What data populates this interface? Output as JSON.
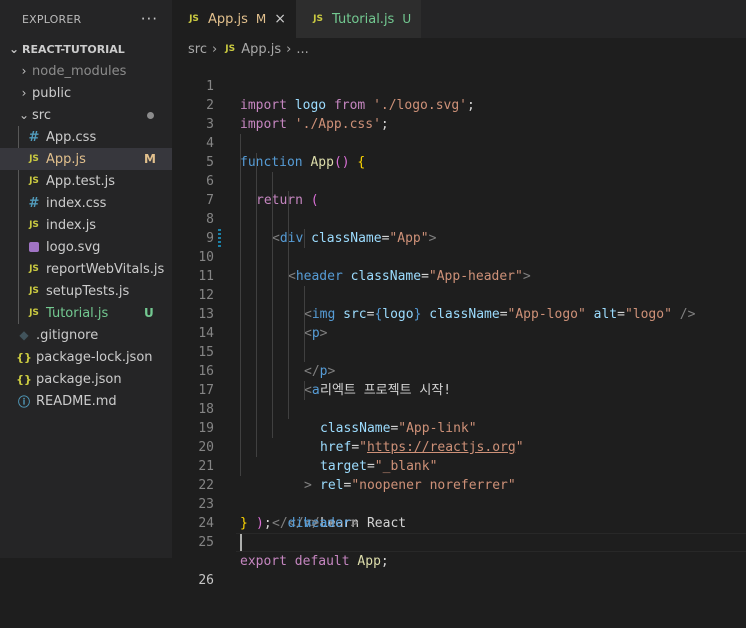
{
  "sidebar": {
    "title": "EXPLORER",
    "more_icon": "ellipsis-icon",
    "project": "REACT-TUTORIAL",
    "items": [
      {
        "label": "node_modules",
        "kind": "folder",
        "expanded": false,
        "muted": true
      },
      {
        "label": "public",
        "kind": "folder",
        "expanded": false
      },
      {
        "label": "src",
        "kind": "folder",
        "expanded": true,
        "status": "modified-dot"
      },
      {
        "label": "App.css",
        "kind": "css",
        "indent": 1
      },
      {
        "label": "App.js",
        "kind": "js",
        "indent": 1,
        "selected": true,
        "badge": "M"
      },
      {
        "label": "App.test.js",
        "kind": "js",
        "indent": 1
      },
      {
        "label": "index.css",
        "kind": "css",
        "indent": 1
      },
      {
        "label": "index.js",
        "kind": "js",
        "indent": 1
      },
      {
        "label": "logo.svg",
        "kind": "svg",
        "indent": 1
      },
      {
        "label": "reportWebVitals.js",
        "kind": "js",
        "indent": 1
      },
      {
        "label": "setupTests.js",
        "kind": "js",
        "indent": 1
      },
      {
        "label": "Tutorial.js",
        "kind": "js",
        "indent": 1,
        "badge": "U"
      },
      {
        "label": ".gitignore",
        "kind": "git"
      },
      {
        "label": "package-lock.json",
        "kind": "json"
      },
      {
        "label": "package.json",
        "kind": "json"
      },
      {
        "label": "README.md",
        "kind": "info"
      }
    ]
  },
  "tabs": [
    {
      "label": "App.js",
      "mark": "M",
      "active": true,
      "close": "×"
    },
    {
      "label": "Tutorial.js",
      "mark": "U",
      "active": false
    }
  ],
  "breadcrumb": {
    "folder": "src",
    "file": "App.js",
    "tail": "..."
  },
  "icons": {
    "js": "JS",
    "css": "#",
    "json": "{}",
    "info": "ⓘ",
    "git": "◆"
  },
  "colors": {
    "modified": "#e2c08d",
    "untracked": "#73c991",
    "background": "#1e1e1e"
  },
  "code": {
    "line_numbers": [
      "1",
      "2",
      "3",
      "4",
      "5",
      "6",
      "7",
      "8",
      "9",
      "10",
      "11",
      "12",
      "13",
      "14",
      "15",
      "16",
      "17",
      "18",
      "19",
      "20",
      "21",
      "22",
      "23",
      "24",
      "25",
      "26"
    ],
    "l1": [
      "import",
      "logo",
      "from",
      "'./logo.svg'",
      ";"
    ],
    "l2": [
      "import",
      "'./App.css'",
      ";"
    ],
    "l4": [
      "function",
      "App",
      "()",
      "{"
    ],
    "l5": [
      "return",
      "("
    ],
    "l6": [
      "<",
      "div",
      "className",
      "=",
      "\"App\"",
      ">"
    ],
    "l7": [
      "<",
      "header",
      "className",
      "=",
      "\"App-header\"",
      ">"
    ],
    "l8": [
      "<",
      "img",
      "src",
      "=",
      "{",
      "logo",
      "}",
      "className",
      "=",
      "\"App-logo\"",
      "alt",
      "=",
      "\"logo\"",
      "/>"
    ],
    "l9": [
      "<",
      "p",
      ">"
    ],
    "l10": "리엑트 프로젝트 시작!",
    "l11": [
      "</",
      "p",
      ">"
    ],
    "l12": [
      "<",
      "a"
    ],
    "l13": [
      "className",
      "=",
      "\"App-link\""
    ],
    "l14": [
      "href",
      "=",
      "\"",
      "https://reactjs.org",
      "\""
    ],
    "l15": [
      "target",
      "=",
      "\"_blank\""
    ],
    "l16": [
      "rel",
      "=",
      "\"noopener noreferrer\""
    ],
    "l17": ">",
    "l18": "Learn React",
    "l19": [
      "</",
      "a",
      ">"
    ],
    "l20": [
      "</",
      "header",
      ">"
    ],
    "l21": [
      "</",
      "div",
      ">"
    ],
    "l22": [
      ")",
      ";"
    ],
    "l23": "}",
    "l25": [
      "export",
      "default",
      "App",
      ";"
    ]
  }
}
